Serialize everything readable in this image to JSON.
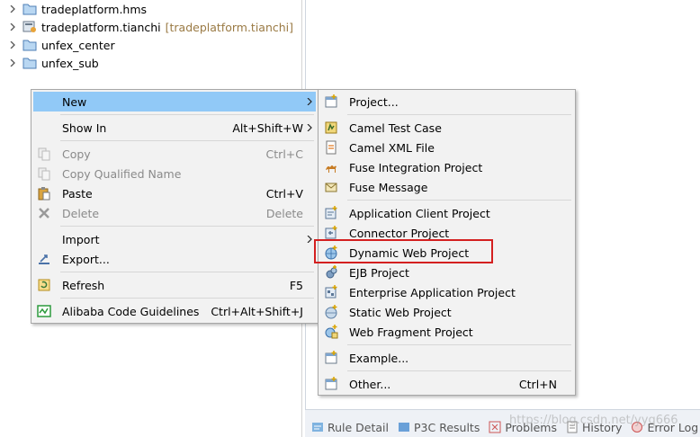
{
  "tree": {
    "items": [
      {
        "label": "tradeplatform.hms",
        "decoration": ""
      },
      {
        "label": "tradeplatform.tianchi",
        "decoration": "[tradeplatform.tianchi]"
      },
      {
        "label": "unfex_center",
        "decoration": ""
      },
      {
        "label": "unfex_sub",
        "decoration": ""
      }
    ]
  },
  "context_menu": {
    "items": [
      {
        "label": "New",
        "accelerator": ""
      },
      {
        "label": "Show In",
        "accelerator": "Alt+Shift+W"
      },
      {
        "label": "Copy",
        "accelerator": "Ctrl+C"
      },
      {
        "label": "Copy Qualified Name",
        "accelerator": ""
      },
      {
        "label": "Paste",
        "accelerator": "Ctrl+V"
      },
      {
        "label": "Delete",
        "accelerator": "Delete"
      },
      {
        "label": "Import",
        "accelerator": ""
      },
      {
        "label": "Export...",
        "accelerator": ""
      },
      {
        "label": "Refresh",
        "accelerator": "F5"
      },
      {
        "label": "Alibaba Code Guidelines",
        "accelerator": "Ctrl+Alt+Shift+J"
      }
    ]
  },
  "submenu": {
    "items": [
      {
        "label": "Project...",
        "accelerator": ""
      },
      {
        "label": "Camel Test Case",
        "accelerator": ""
      },
      {
        "label": "Camel XML File",
        "accelerator": ""
      },
      {
        "label": "Fuse Integration Project",
        "accelerator": ""
      },
      {
        "label": "Fuse Message",
        "accelerator": ""
      },
      {
        "label": "Application Client Project",
        "accelerator": ""
      },
      {
        "label": "Connector Project",
        "accelerator": ""
      },
      {
        "label": "Dynamic Web Project",
        "accelerator": ""
      },
      {
        "label": "EJB Project",
        "accelerator": ""
      },
      {
        "label": "Enterprise Application Project",
        "accelerator": ""
      },
      {
        "label": "Static Web Project",
        "accelerator": ""
      },
      {
        "label": "Web Fragment Project",
        "accelerator": ""
      },
      {
        "label": "Example...",
        "accelerator": ""
      },
      {
        "label": "Other...",
        "accelerator": "Ctrl+N"
      }
    ]
  },
  "bottom_tabs": [
    {
      "label": "Rule Detail"
    },
    {
      "label": "P3C Results"
    },
    {
      "label": "Problems"
    },
    {
      "label": "History"
    },
    {
      "label": "Error Log"
    }
  ],
  "watermark": "https://blog.csdn.net/yyq666",
  "colors": {
    "highlight": "#91c9f7",
    "annotation_box": "#d42020",
    "menu_bg": "#f2f2f2"
  }
}
